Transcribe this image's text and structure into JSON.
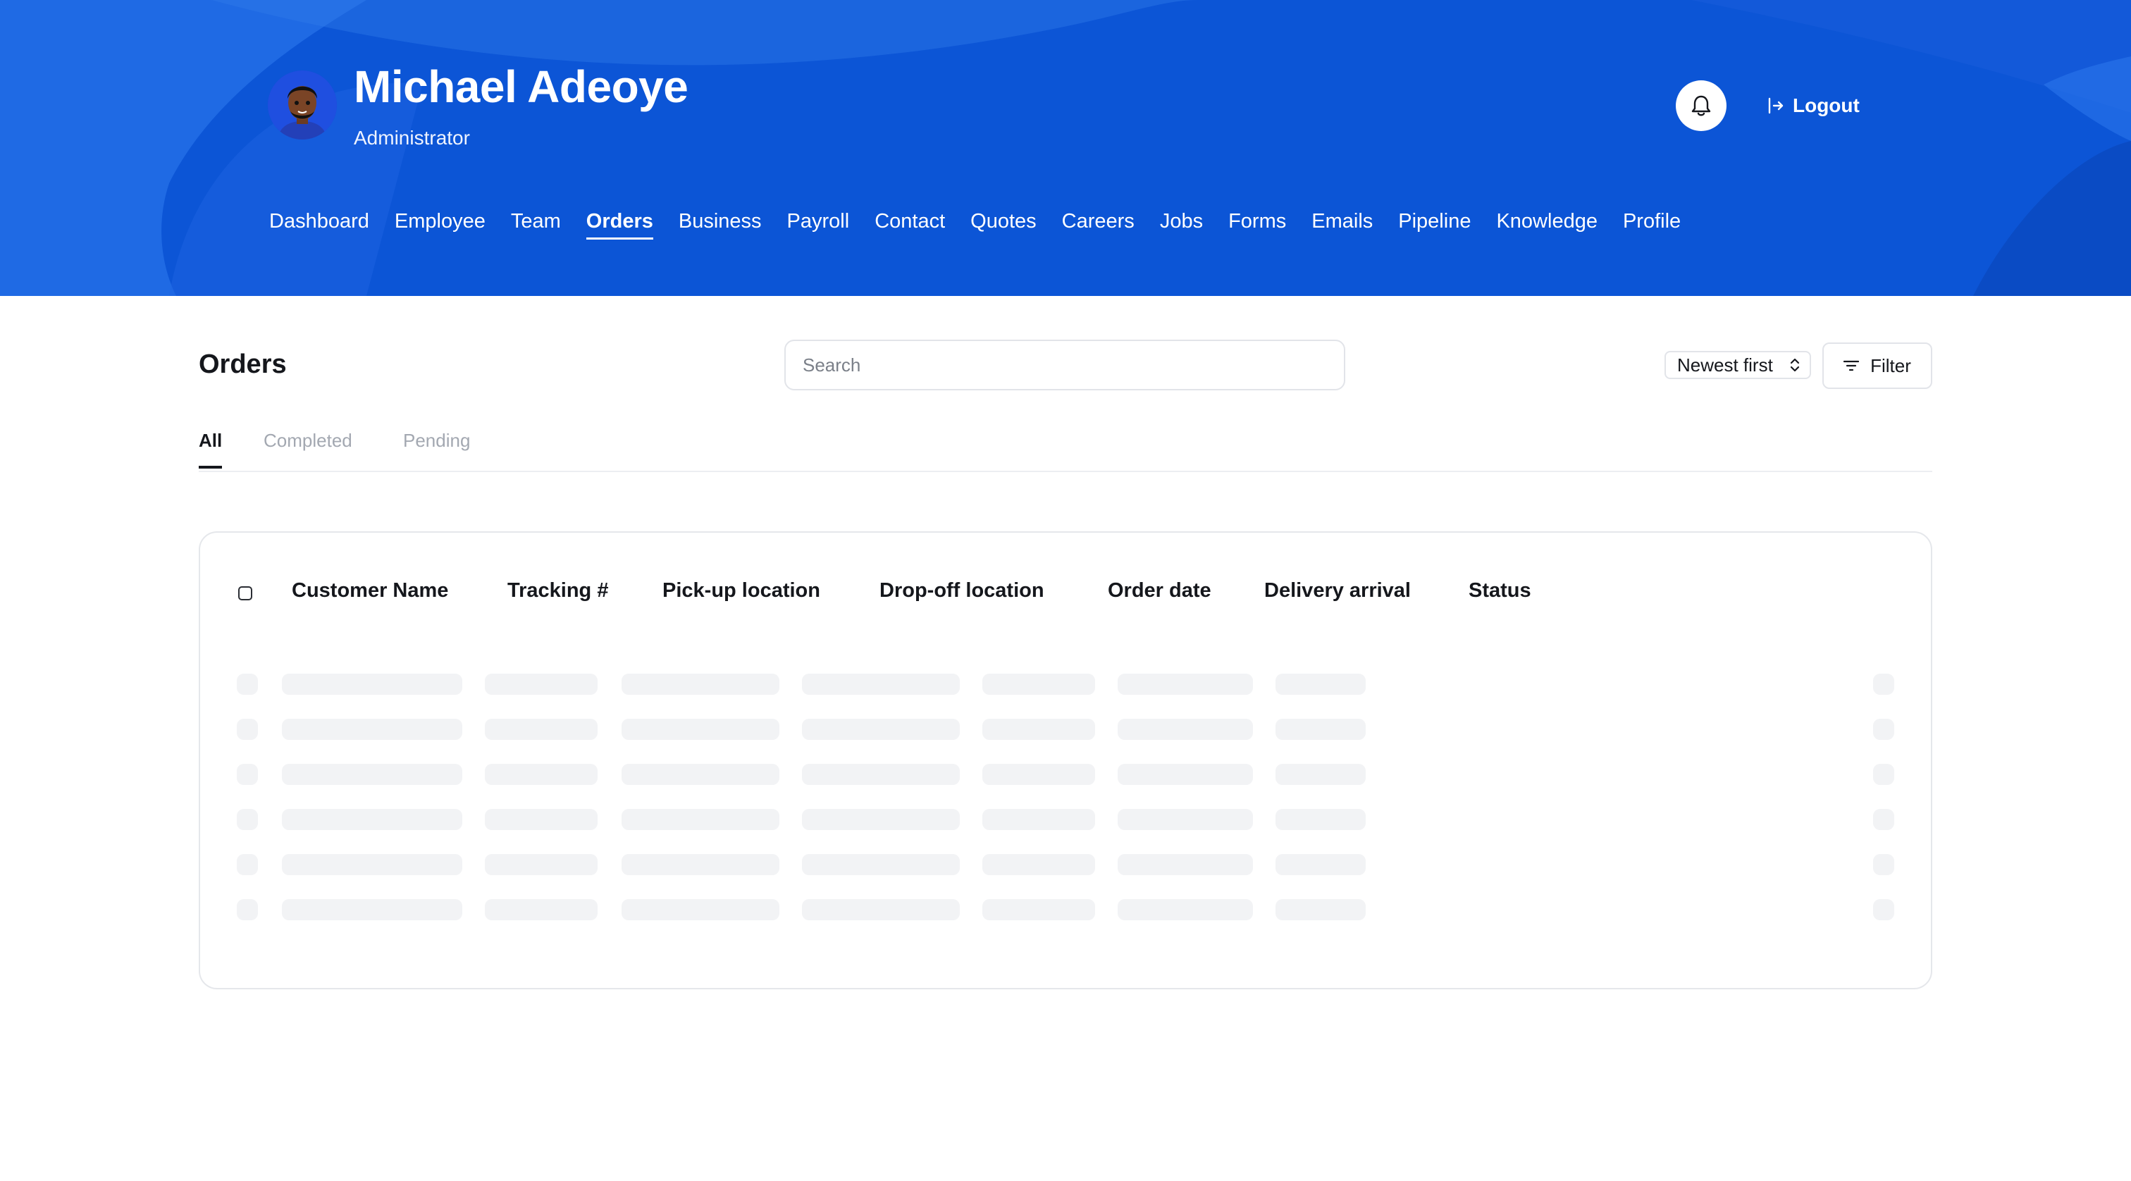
{
  "header": {
    "user_name": "Michael Adeoye",
    "user_role": "Administrator",
    "logout_label": "Logout",
    "nav": [
      {
        "label": "Dashboard",
        "active": false
      },
      {
        "label": "Employee",
        "active": false
      },
      {
        "label": "Team",
        "active": false
      },
      {
        "label": "Orders",
        "active": true
      },
      {
        "label": "Business",
        "active": false
      },
      {
        "label": "Payroll",
        "active": false
      },
      {
        "label": "Contact",
        "active": false
      },
      {
        "label": "Quotes",
        "active": false
      },
      {
        "label": "Careers",
        "active": false
      },
      {
        "label": "Jobs",
        "active": false
      },
      {
        "label": "Forms",
        "active": false
      },
      {
        "label": "Emails",
        "active": false
      },
      {
        "label": "Pipeline",
        "active": false
      },
      {
        "label": "Knowledge",
        "active": false
      },
      {
        "label": "Profile",
        "active": false
      }
    ]
  },
  "toolbar": {
    "title": "Orders",
    "search_placeholder": "Search",
    "sort_value": "Newest first",
    "filter_label": "Filter"
  },
  "tabs": [
    {
      "label": "All",
      "active": true
    },
    {
      "label": "Completed",
      "active": false
    },
    {
      "label": "Pending",
      "active": false
    }
  ],
  "table": {
    "columns": [
      "Customer Name",
      "Tracking #",
      "Pick-up location",
      "Drop-off location",
      "Order date",
      "Delivery arrival",
      "Status"
    ],
    "loading_rows": 6
  },
  "colors": {
    "header_bg": "#0c55d6",
    "skeleton": "#f2f3f5",
    "border": "#e5e7eb"
  },
  "icons": {
    "bell": "bell-icon",
    "logout": "logout-icon",
    "sort": "chevron-up-down-icon",
    "filter": "filter-icon"
  }
}
